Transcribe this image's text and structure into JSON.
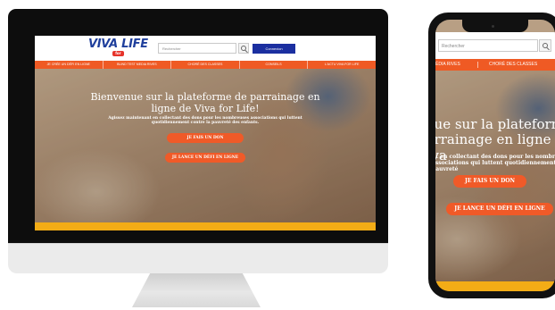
{
  "desktop": {
    "logo": {
      "main": "VIVA LIFE",
      "sub": "for"
    },
    "search": {
      "placeholder": "Rechercher"
    },
    "connect_label": "Connexion",
    "nav": [
      "JE CRÉE UN DÉFI EN LIGNE",
      "BLIND TEST MEDIA RIVES",
      "CHORÉ DES CLASSES",
      "CONSEILS",
      "L'ACTU VIVA FOR LIFE"
    ],
    "hero": {
      "title": "Bienvenue sur la plateforme de parrainage en ligne de Viva for Life!",
      "text": "Agissez maintenant en collectant des dons pour les nombreuses associations qui luttent quotidiennement contre la pauvreté des enfants.",
      "donate_label": "JE FAIS UN DON",
      "challenge_label": "JE LANCE UN DÉFI EN LIGNE"
    }
  },
  "mobile": {
    "search": {
      "placeholder": "Rechercher"
    },
    "nav": [
      "ÉDIA RIVES",
      "CHORÉ DES CLASSES"
    ],
    "hero": {
      "title": "enue sur la plateforme de parrainage en ligne de Viva",
      "text": "nt en collectant des dons pour les nombreuses associations qui luttent quotidiennement contre la pauvreté",
      "donate_label": "JE FAIS UN DON",
      "challenge_label": "JE LANCE UN DÉFI EN LIGNE"
    }
  },
  "colors": {
    "nav_orange": "#ef5a24",
    "button_orange": "#f05a28",
    "connect_blue": "#1b2fa0",
    "footer_yellow": "#f3ac16",
    "logo_blue": "#1f3f9c",
    "logo_red": "#e6332a"
  },
  "icons": {
    "search": "magnifier-icon"
  }
}
